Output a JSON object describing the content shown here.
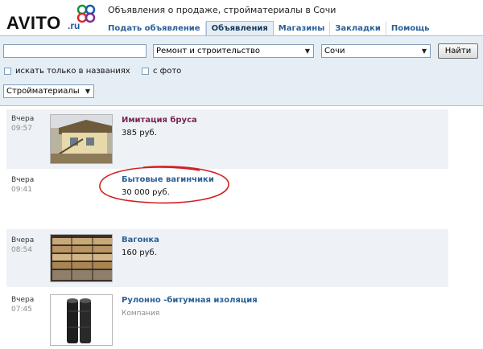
{
  "header": {
    "logo_text": "AVITO",
    "logo_suffix": ".ru",
    "title": "Объявления о продаже, стройматериалы в Сочи",
    "tabs": [
      {
        "label": "Подать объявление"
      },
      {
        "label": "Объявления",
        "active": true
      },
      {
        "label": "Магазины"
      },
      {
        "label": "Закладки"
      },
      {
        "label": "Помощь"
      }
    ]
  },
  "search": {
    "query": "",
    "category": "Ремонт и строительство",
    "city": "Сочи",
    "submit_label": "Найти",
    "titles_only_label": "искать только в названиях",
    "with_photo_label": "с фото",
    "subcategory": "Стройматериалы"
  },
  "listings": [
    {
      "day": "Вчера",
      "time": "09:57",
      "title": "Имитация бруса",
      "price": "385 руб.",
      "has_photo": true,
      "visited": true
    },
    {
      "day": "Вчера",
      "time": "09:41",
      "title": "Бытовые вагинчики",
      "price": "30 000 руб.",
      "has_photo": false,
      "circled": true
    },
    {
      "day": "Вчера",
      "time": "08:54",
      "title": "Вагонка",
      "price": "160 руб.",
      "has_photo": true
    },
    {
      "day": "Вчера",
      "time": "07:45",
      "title": "Рулонно -битумная изоляция",
      "company": "Компания",
      "has_photo": true
    }
  ],
  "colors": {
    "link": "#2a6098",
    "visited_link": "#7a2452",
    "panel": "#e6eef5",
    "annotation": "#d42020"
  },
  "icons": [
    "dropdown-arrow-icon",
    "checkbox-icon",
    "logo-mark-icon"
  ]
}
